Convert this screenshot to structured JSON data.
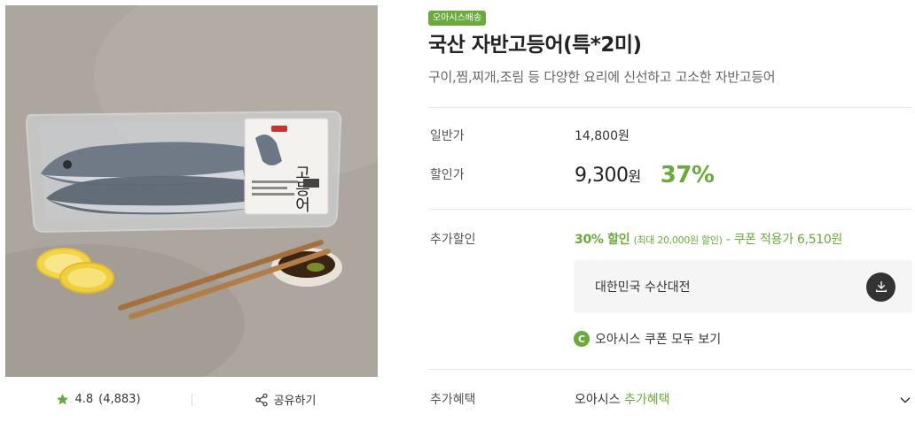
{
  "image": {
    "alt": "국산 자반고등어 상품 이미지",
    "package_label_text": "고등어"
  },
  "rating": {
    "score": "4.8",
    "count": "(4,883)"
  },
  "share": {
    "label": "공유하기"
  },
  "badge": {
    "label": "오아시스배송"
  },
  "product": {
    "title": "국산 자반고등어(특*2미)",
    "subtitle": "구이,찜,찌개,조림 등 다양한 요리에 신선하고 고소한 자반고등어"
  },
  "price": {
    "normal_label": "일반가",
    "normal_value": "14,800원",
    "sale_label": "할인가",
    "sale_amount": "9,300",
    "sale_unit": "원",
    "discount_rate": "37%"
  },
  "extra_discount": {
    "label": "추가할인",
    "rate": "30% 할인",
    "max": "(최대 20,000원 할인)",
    "separator": " - 쿠폰 적용가 ",
    "coupon_price": "6,510원"
  },
  "coupon": {
    "name": "대한민국 수산대전"
  },
  "all_coupons": {
    "icon_letter": "C",
    "label": "오아시스 쿠폰 모두 보기"
  },
  "benefit": {
    "label": "추가혜택",
    "value_prefix": "오아시스 ",
    "value_highlight": "추가혜택"
  },
  "colors": {
    "accent": "#6aaa3d",
    "text": "#222222",
    "muted": "#666666",
    "box_bg": "#f5f5f5"
  },
  "icons": {
    "rating": "star-icon",
    "share": "share-icon",
    "download": "download-icon",
    "coupon": "coupon-c-icon",
    "expand": "chevron-down-icon"
  }
}
